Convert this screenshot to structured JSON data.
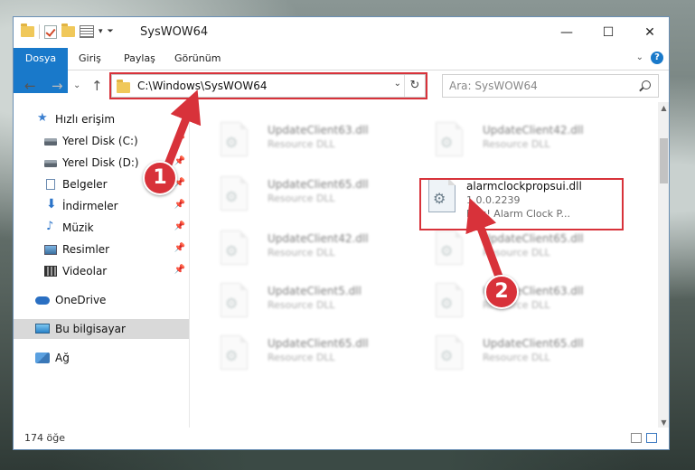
{
  "window": {
    "title": "SysWOW64",
    "controls": {
      "minimize": "—",
      "maximize": "☐",
      "close": "✕"
    }
  },
  "ribbon": {
    "tabs": [
      "Dosya",
      "Giriş",
      "Paylaş",
      "Görünüm"
    ],
    "help": "?"
  },
  "address": {
    "path": "C:\\Windows\\SysWOW64",
    "search_placeholder": "Ara: SysWOW64"
  },
  "sidebar": {
    "items": [
      {
        "label": "Hızlı erişim",
        "icon": "star-icon"
      },
      {
        "label": "Yerel Disk (C:)",
        "icon": "drive-icon",
        "pinned": true
      },
      {
        "label": "Yerel Disk (D:)",
        "icon": "drive-icon",
        "pinned": true
      },
      {
        "label": "Belgeler",
        "icon": "documents-icon",
        "pinned": true
      },
      {
        "label": "İndirmeler",
        "icon": "download-icon",
        "pinned": true
      },
      {
        "label": "Müzik",
        "icon": "music-icon",
        "pinned": true
      },
      {
        "label": "Resimler",
        "icon": "pictures-icon",
        "pinned": true
      },
      {
        "label": "Videolar",
        "icon": "video-icon",
        "pinned": true
      },
      {
        "label": "OneDrive",
        "icon": "cloud-icon"
      },
      {
        "label": "Bu bilgisayar",
        "icon": "computer-icon",
        "selected": true
      },
      {
        "label": "Ağ",
        "icon": "network-icon"
      }
    ]
  },
  "files": [
    {
      "name": "UpdateClient63.dll",
      "line1": "Resource DLL",
      "line2": ""
    },
    {
      "name": "UpdateClient42.dll",
      "line1": "Resource DLL",
      "line2": ""
    },
    {
      "name": "UpdateClient65.dll",
      "line1": "Resource DLL",
      "line2": ""
    },
    {
      "name": "alarmclockpropsui.dll",
      "line1": "1.0.0.2239",
      "line2": "Plus! Alarm Clock P..."
    },
    {
      "name": "UpdateClient42.dll",
      "line1": "Resource DLL",
      "line2": ""
    },
    {
      "name": "UpdateClient65.dll",
      "line1": "Resource DLL",
      "line2": ""
    },
    {
      "name": "UpdateClient5.dll",
      "line1": "Resource DLL",
      "line2": ""
    },
    {
      "name": "UpdateClient63.dll",
      "line1": "Resource DLL",
      "line2": ""
    },
    {
      "name": "UpdateClient65.dll",
      "line1": "Resource DLL",
      "line2": ""
    },
    {
      "name": "UpdateClient65.dll",
      "line1": "Resource DLL",
      "line2": ""
    }
  ],
  "status": {
    "count": "174 öğe"
  },
  "annotations": {
    "step1": "1",
    "step2": "2",
    "color": "#d8323a"
  }
}
